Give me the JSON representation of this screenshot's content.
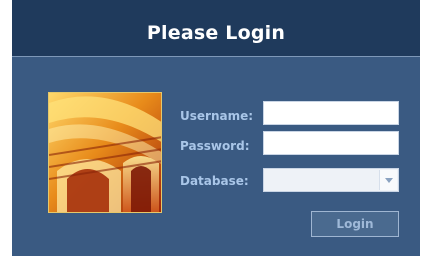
{
  "dialog": {
    "title": "Please Login"
  },
  "form": {
    "username_label": "Username:",
    "username_value": "",
    "password_label": "Password:",
    "password_value": "",
    "database_label": "Database:",
    "database_value": ""
  },
  "buttons": {
    "login_label": "Login"
  },
  "colors": {
    "panel": "#3a5a82",
    "titlebar": "#1f3a5c",
    "label": "#a9c6e8",
    "button": "#4a6a8f"
  },
  "icons": {
    "dropdown": "chevron-down-icon",
    "artwork": "architectural-arches-image"
  }
}
